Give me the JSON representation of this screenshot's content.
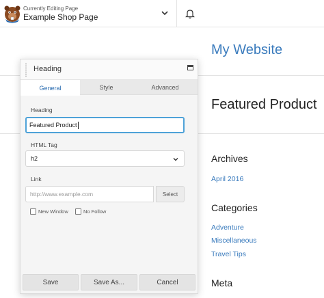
{
  "topbar": {
    "editing_label": "Currently Editing Page",
    "page_name": "Example Shop Page",
    "icons": [
      "beaver-logo-icon",
      "chevron-down-icon",
      "bell-icon"
    ]
  },
  "site": {
    "title": "My Website",
    "post_title": "Featured Product",
    "archives_heading": "Archives",
    "archives_links": [
      "April 2016"
    ],
    "categories_heading": "Categories",
    "categories_links": [
      "Adventure",
      "Miscellaneous",
      "Travel Tips"
    ],
    "meta_heading": "Meta"
  },
  "panel": {
    "title": "Heading",
    "tabs": [
      {
        "label": "General",
        "active": true
      },
      {
        "label": "Style",
        "active": false
      },
      {
        "label": "Advanced",
        "active": false
      }
    ],
    "heading_field": {
      "label": "Heading",
      "value": "Featured Product"
    },
    "html_tag_field": {
      "label": "HTML Tag",
      "value": "h2"
    },
    "link_field": {
      "label": "Link",
      "placeholder": "http://www.example.com",
      "select_label": "Select"
    },
    "checkboxes": [
      {
        "label": "New Window",
        "checked": false
      },
      {
        "label": "No Follow",
        "checked": false
      }
    ],
    "buttons": {
      "save": "Save",
      "save_as": "Save As...",
      "cancel": "Cancel"
    }
  },
  "colors": {
    "accent": "#3a7bbd",
    "focus_border": "#4ea2d8",
    "active_tab_text": "#2a6cb0"
  }
}
